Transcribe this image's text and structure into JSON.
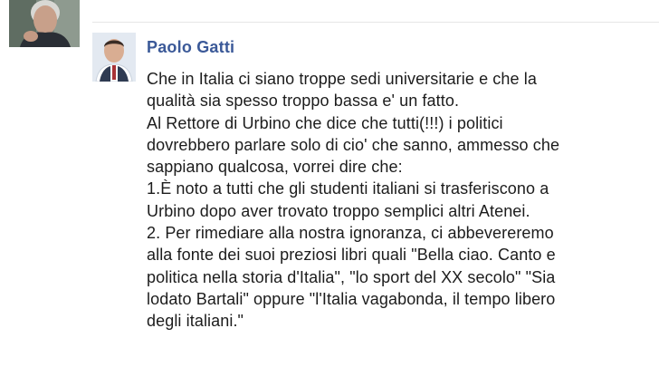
{
  "comment": {
    "author": "Paolo Gatti",
    "lines": [
      "Che in Italia ci siano troppe sedi universitarie e che la",
      "qualità sia spesso troppo bassa e' un fatto.",
      "Al Rettore di Urbino che dice che tutti(!!!) i politici",
      "dovrebbero parlare solo di cio' che sanno, ammesso che",
      "sappiano qualcosa, vorrei dire che:",
      "1.È noto a tutti che gli studenti italiani si trasferiscono a",
      "Urbino dopo aver trovato troppo semplici altri Atenei.",
      "2. Per rimediare alla nostra ignoranza, ci abbevereremo",
      "alla fonte dei suoi preziosi libri quali \"Bella ciao. Canto e",
      "politica nella storia d'Italia\", \"lo sport del XX secolo\" \"Sia",
      "lodato Bartali\" oppure \"l'Italia vagabonda, il tempo libero",
      "degli italiani.\""
    ]
  },
  "colors": {
    "author_link": "#3b5998",
    "text": "#1c1c1c",
    "divider": "#e6e6e6"
  }
}
